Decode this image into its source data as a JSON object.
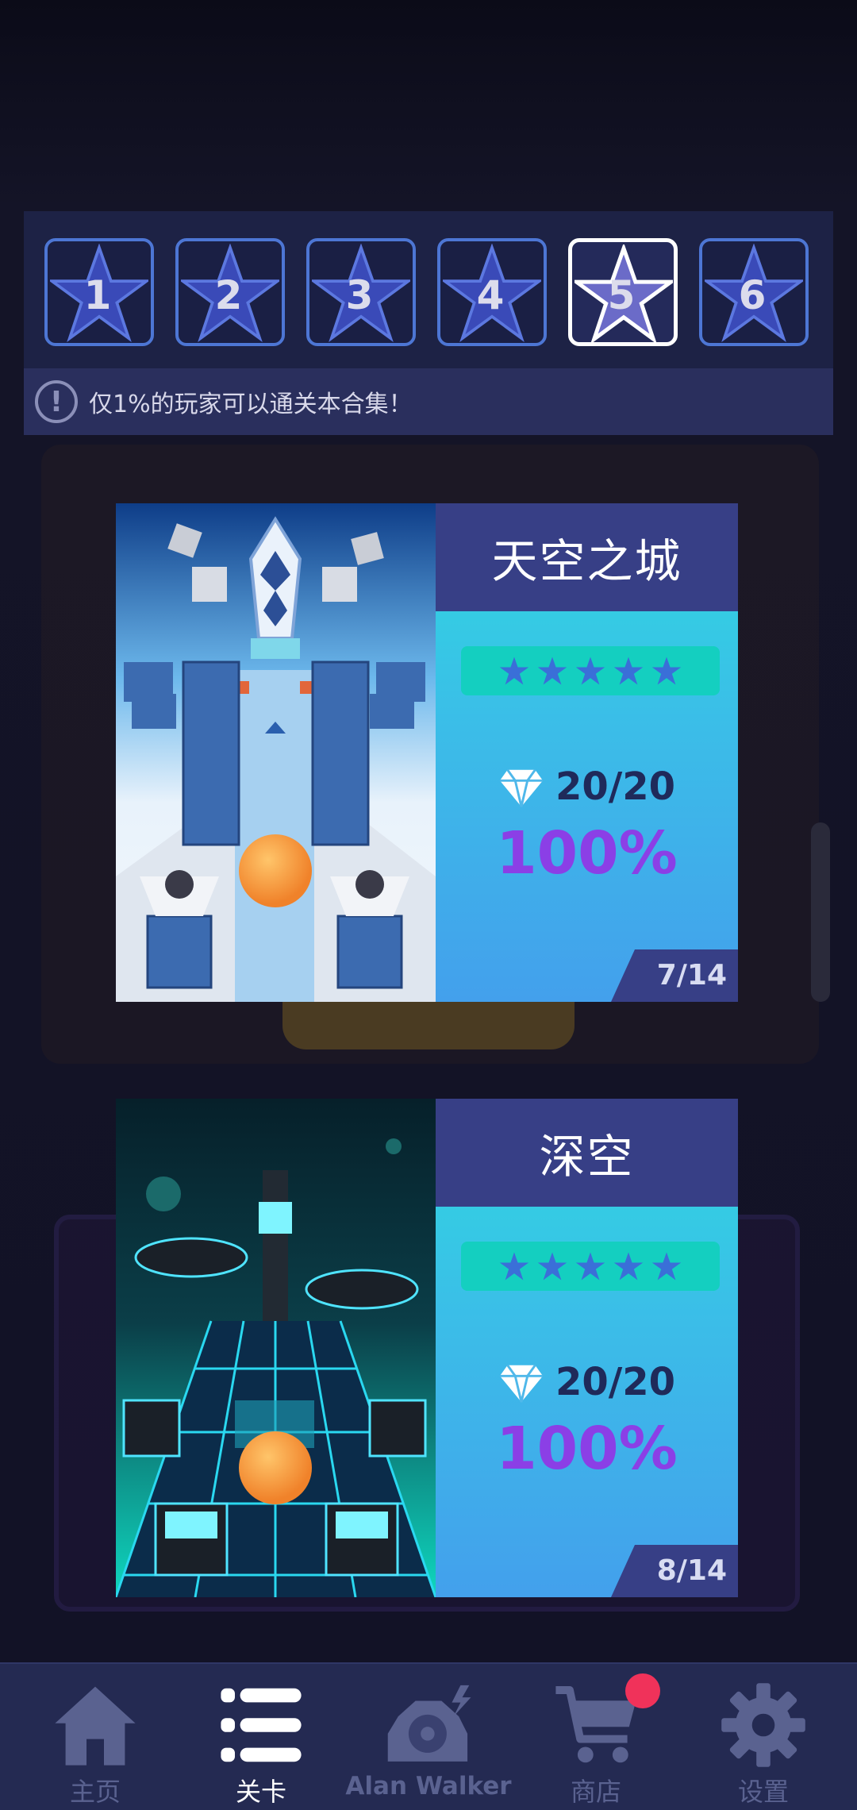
{
  "world_selector": {
    "worlds": [
      {
        "number": "1",
        "active": false
      },
      {
        "number": "2",
        "active": false
      },
      {
        "number": "3",
        "active": false
      },
      {
        "number": "4",
        "active": false
      },
      {
        "number": "5",
        "active": true
      },
      {
        "number": "6",
        "active": false
      }
    ],
    "notice_icon": "!",
    "notice_text": "仅1%的玩家可以通关本合集！"
  },
  "levels": [
    {
      "title": "天空之城",
      "stars": 5,
      "gems": "20/20",
      "percent": "100%",
      "index": "7/14",
      "theme": "sky-city"
    },
    {
      "title": "深空",
      "stars": 5,
      "gems": "20/20",
      "percent": "100%",
      "index": "8/14",
      "theme": "deep-space"
    }
  ],
  "bottom_nav": {
    "items": [
      {
        "label": "主页",
        "icon": "home-icon",
        "active": false
      },
      {
        "label": "关卡",
        "icon": "list-icon",
        "active": true
      },
      {
        "label": "Alan Walker",
        "icon": "record-player-icon",
        "active": false
      },
      {
        "label": "商店",
        "icon": "cart-icon",
        "active": false,
        "badge": true
      },
      {
        "label": "设置",
        "icon": "gear-icon",
        "active": false
      }
    ]
  },
  "colors": {
    "accent_purple": "#8b3fe6",
    "title_bar": "#373f86",
    "badge_red": "#f0325a",
    "nav_bg": "#242a52"
  }
}
